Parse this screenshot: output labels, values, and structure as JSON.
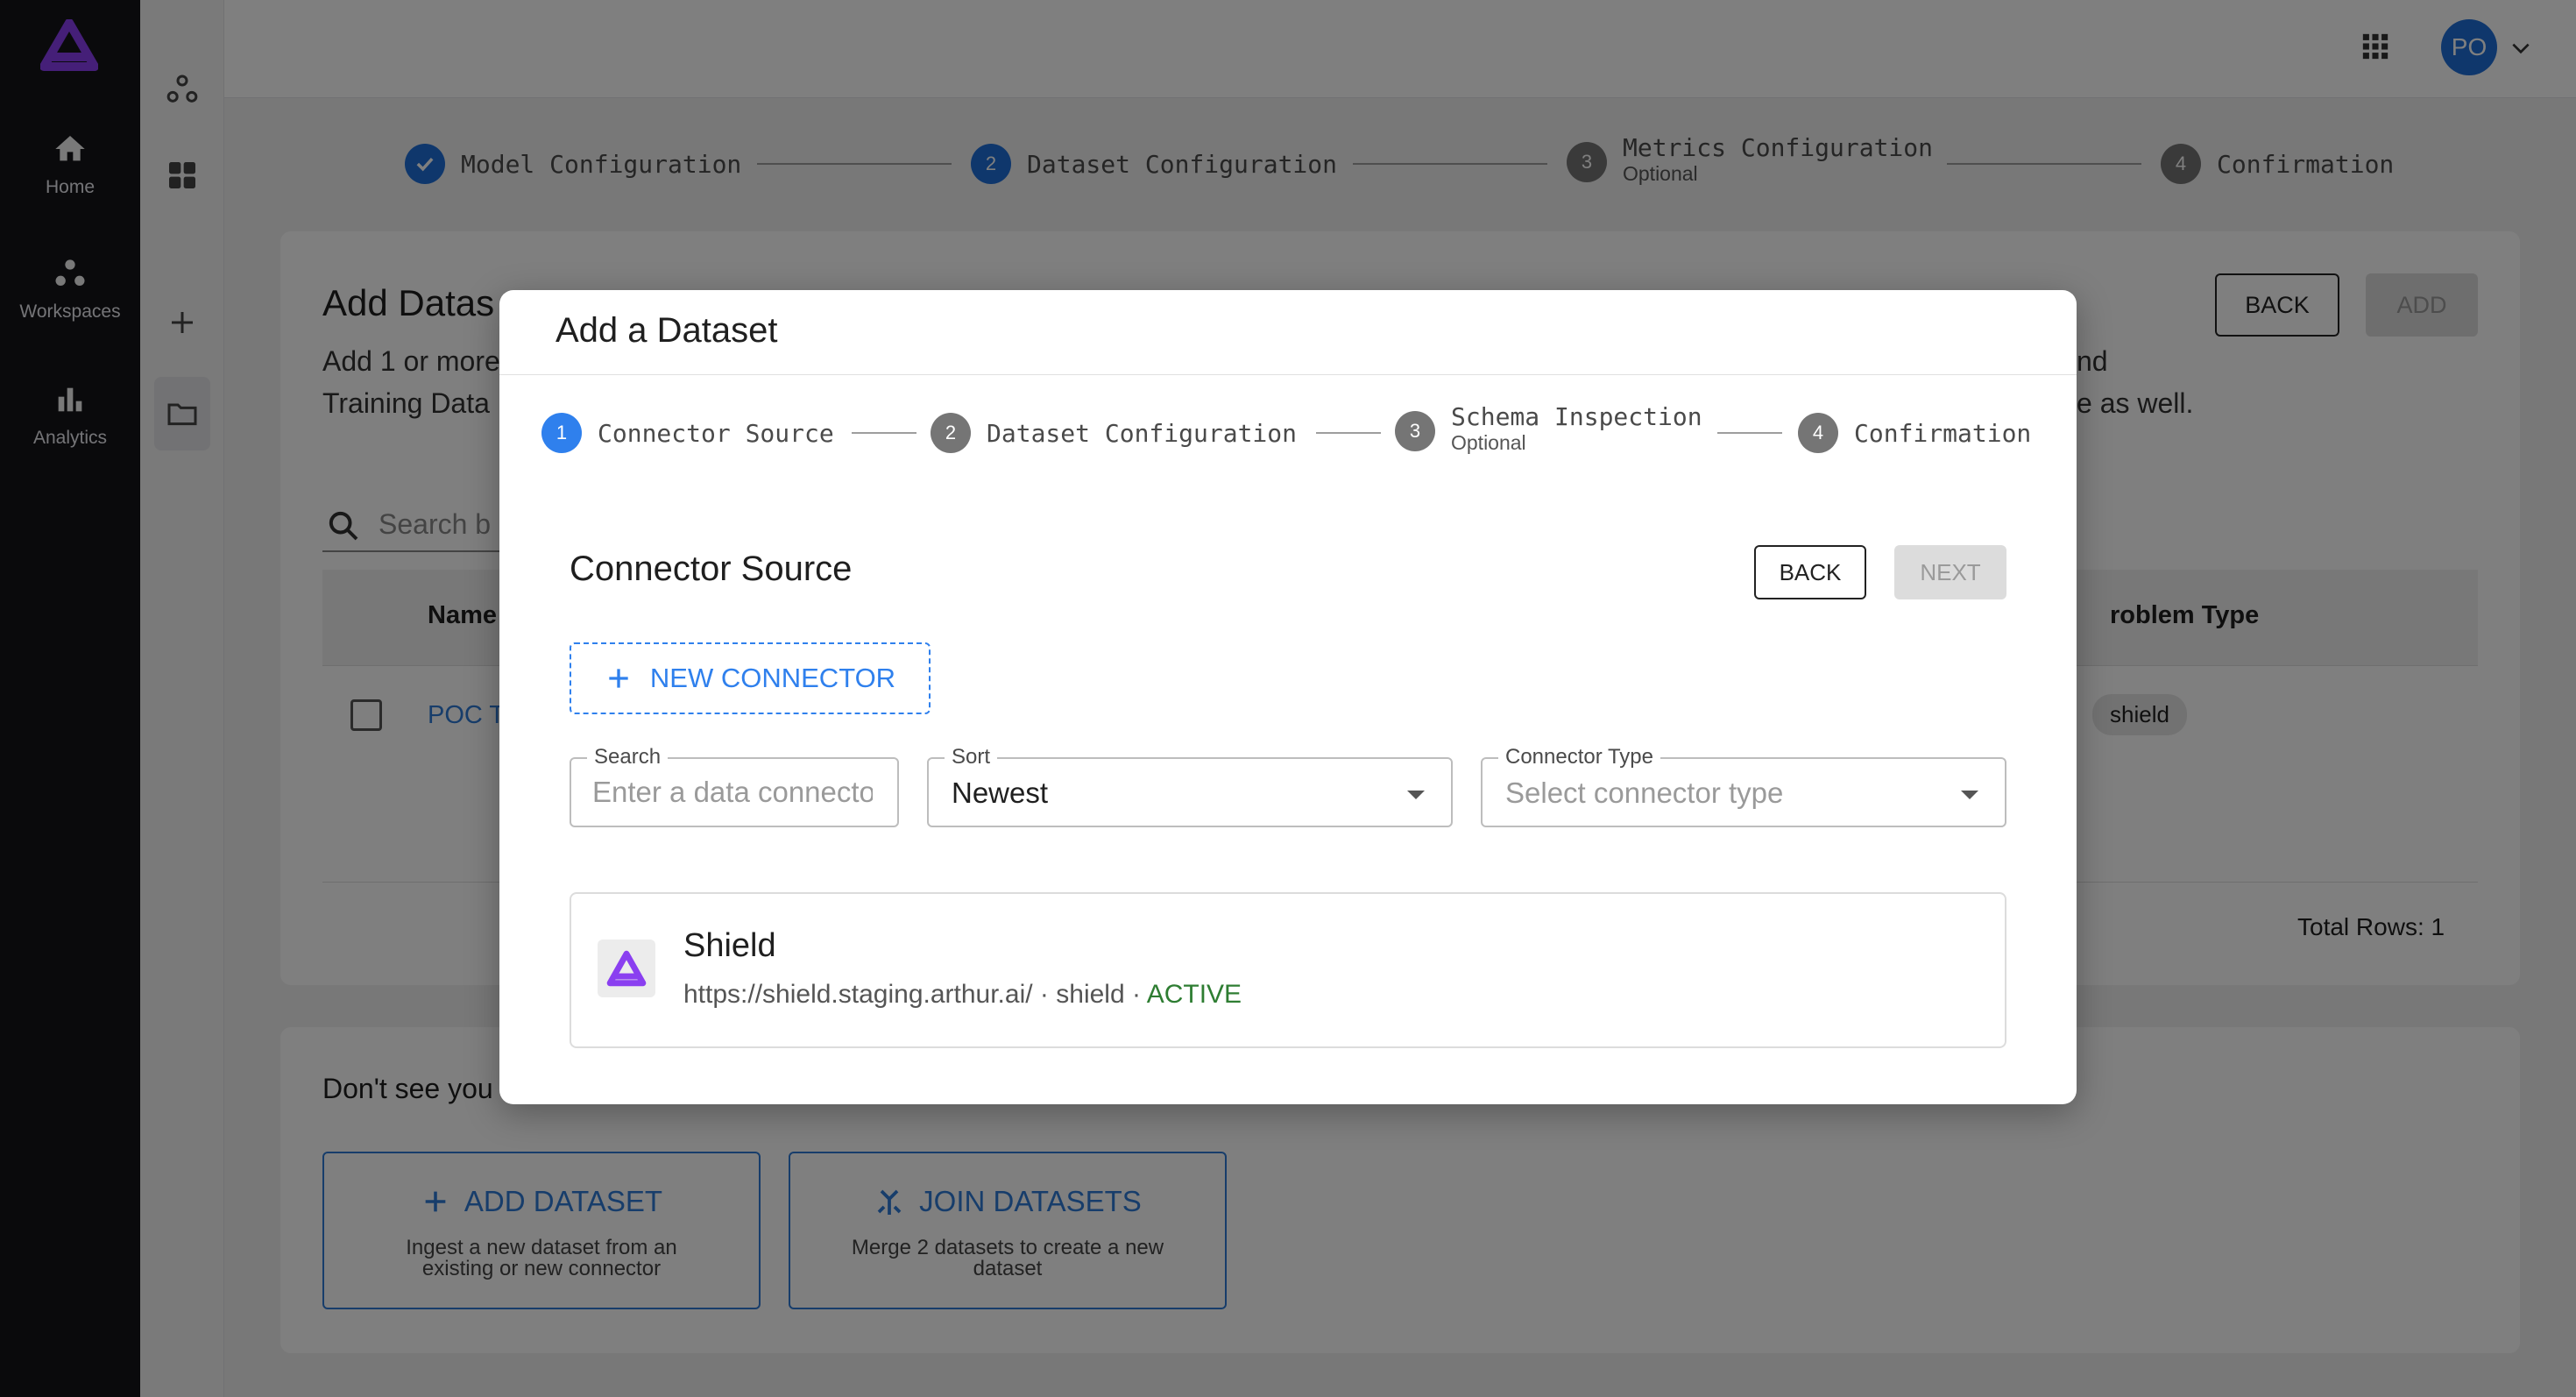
{
  "nav": {
    "items": [
      {
        "label": "Home",
        "icon": "home-icon"
      },
      {
        "label": "Workspaces",
        "icon": "workspaces-icon"
      },
      {
        "label": "Analytics",
        "icon": "analytics-icon"
      }
    ]
  },
  "topbar": {
    "avatar_initials": "PO"
  },
  "page_stepper": {
    "steps": [
      {
        "number": "1",
        "label": "Model Configuration",
        "state": "completed"
      },
      {
        "number": "2",
        "label": "Dataset Configuration",
        "state": "active"
      },
      {
        "number": "3",
        "label": "Metrics Configuration",
        "sublabel": "Optional",
        "state": "pending"
      },
      {
        "number": "4",
        "label": "Confirmation",
        "state": "pending"
      }
    ]
  },
  "add_datasets_card": {
    "title": "Add Datas",
    "description_line1": "Add 1 or more",
    "description_line1_tail": "nd",
    "description_line2": "Training Data",
    "description_line2_tail": "e as well.",
    "back_label": "BACK",
    "add_label": "ADD",
    "search_placeholder": "Search b",
    "columns": {
      "name": "Name",
      "problem_type": "roblem Type"
    },
    "rows": [
      {
        "name": "POC T",
        "problem_type": "shield"
      }
    ],
    "total_rows": "Total Rows: 1"
  },
  "bottom_card": {
    "prompt": "Don't see you",
    "add_dataset": {
      "label": "ADD DATASET",
      "desc": "Ingest a new dataset from an existing or new connector"
    },
    "join_datasets": {
      "label": "JOIN DATASETS",
      "desc": "Merge 2 datasets to create a new dataset"
    }
  },
  "modal": {
    "title": "Add a Dataset",
    "steps": [
      {
        "number": "1",
        "label": "Connector Source",
        "state": "active"
      },
      {
        "number": "2",
        "label": "Dataset Configuration",
        "state": "pending"
      },
      {
        "number": "3",
        "label": "Schema Inspection",
        "sublabel": "Optional",
        "state": "pending"
      },
      {
        "number": "4",
        "label": "Confirmation",
        "state": "pending"
      }
    ],
    "section_title": "Connector Source",
    "back_label": "BACK",
    "next_label": "NEXT",
    "new_connector_label": "NEW CONNECTOR",
    "search": {
      "label": "Search",
      "placeholder": "Enter a data connector"
    },
    "sort": {
      "label": "Sort",
      "value": "Newest"
    },
    "connector_type": {
      "label": "Connector Type",
      "placeholder": "Select connector type"
    },
    "connector": {
      "name": "Shield",
      "url": "https://shield.staging.arthur.ai/",
      "sep1": "·",
      "type": "shield",
      "sep2": "·",
      "status": "ACTIVE"
    }
  },
  "colors": {
    "brand_purple": "#7b2ff2",
    "primary_blue": "#1e6fd9",
    "link_blue": "#2e7bd6",
    "active_green": "#2e7d32",
    "nav_bg": "#141419"
  }
}
